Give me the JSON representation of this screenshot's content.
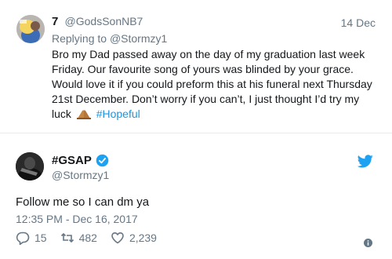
{
  "reply_tweet": {
    "name": "7",
    "handle": "@GodsSonNB7",
    "date": "14 Dec",
    "replying_to_prefix": "Replying to",
    "replying_to_handle": "@Stormzy1",
    "text": "Bro my Dad passed away on the day of my graduation last week Friday. Our favourite song of yours was blinded by your grace. Would love it if you could preform this at his funeral next Thursday 21st December. Don’t worry if you can’t, I just thought I’d try my luck",
    "emoji_icon": "folded-hands-icon",
    "hashtag": "#Hopeful"
  },
  "main_tweet": {
    "name": "#GSAP",
    "handle": "@Stormzy1",
    "verified_icon": "verified-badge-icon",
    "platform_icon": "twitter-bird-icon",
    "text": "Follow me so I can dm ya",
    "timestamp": "12:35 PM - Dec 16, 2017",
    "stats": {
      "replies": "15",
      "retweets": "482",
      "likes": "2,239"
    },
    "info_icon": "info-icon"
  },
  "colors": {
    "accent": "#1da1f2",
    "hashtag": "#1b95e0",
    "muted": "#657786",
    "text": "#14171a",
    "divider": "#e6ecf0"
  }
}
